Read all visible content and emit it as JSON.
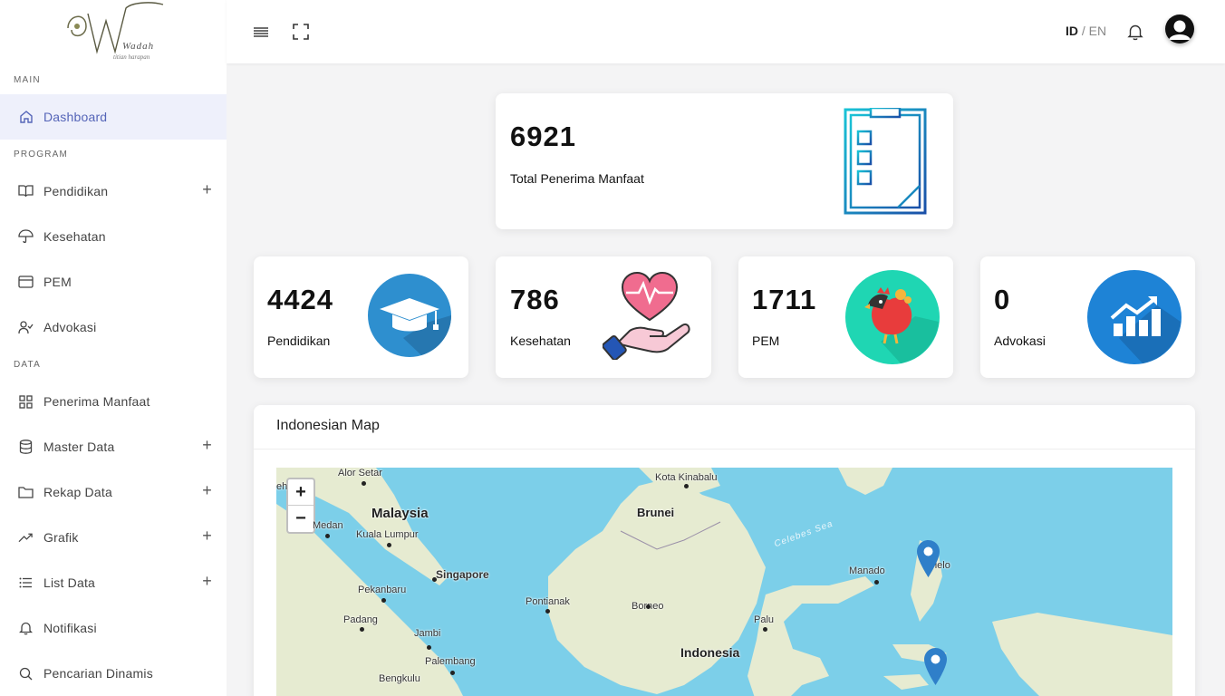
{
  "brand": {
    "logo_text": "Wadah",
    "logo_sub": "titian harapan"
  },
  "sidebar": {
    "sections": {
      "main": "MAIN",
      "program": "PROGRAM",
      "data": "DATA"
    },
    "items": [
      {
        "label": "Dashboard",
        "icon": "home-icon"
      },
      {
        "label": "Pendidikan",
        "icon": "book-icon"
      },
      {
        "label": "Kesehatan",
        "icon": "umbrella-icon"
      },
      {
        "label": "PEM",
        "icon": "card-icon"
      },
      {
        "label": "Advokasi",
        "icon": "user-check-icon"
      },
      {
        "label": "Penerima Manfaat",
        "icon": "grid-icon"
      },
      {
        "label": "Master Data",
        "icon": "database-icon"
      },
      {
        "label": "Rekap Data",
        "icon": "folder-icon"
      },
      {
        "label": "Grafik",
        "icon": "trending-up-icon"
      },
      {
        "label": "List Data",
        "icon": "list-icon"
      },
      {
        "label": "Notifikasi",
        "icon": "bell-icon"
      },
      {
        "label": "Pencarian Dinamis",
        "icon": "search-icon"
      }
    ],
    "plus": "+"
  },
  "topbar": {
    "lang_active": "ID",
    "lang_sep": " / ",
    "lang_other": "EN"
  },
  "cards": {
    "total": {
      "value": "6921",
      "label": "Total Penerima Manfaat"
    },
    "pendidikan": {
      "value": "4424",
      "label": "Pendidikan"
    },
    "kesehatan": {
      "value": "786",
      "label": "Kesehatan"
    },
    "pem": {
      "value": "1711",
      "label": "PEM"
    },
    "advokasi": {
      "value": "0",
      "label": "Advokasi"
    }
  },
  "map": {
    "title": "Indonesian Map",
    "zoom_in": "+",
    "zoom_out": "−",
    "labels": {
      "alor_setar": "Alor Setar",
      "kota_kinabalu": "Kota Kinabalu",
      "malaysia": "Malaysia",
      "brunei": "Brunei",
      "medan": "Medan",
      "kuala_lumpur": "Kuala Lumpur",
      "singapore": "Singapore",
      "celebes_sea": "Celebes Sea",
      "manado": "Manado",
      "ternate": "Tlelo",
      "pekanbaru": "Pekanbaru",
      "pontianak": "Pontianak",
      "borneo": "Borneo",
      "padang": "Padang",
      "jambi": "Jambi",
      "palu": "Palu",
      "indonesia": "Indonesia",
      "palembang": "Palembang",
      "bengkulu": "Bengkulu",
      "edge": "eh"
    },
    "colors": {
      "sea": "#7ccfe9",
      "land": "#e6ebd1",
      "marker": "#2f7fc9"
    }
  }
}
